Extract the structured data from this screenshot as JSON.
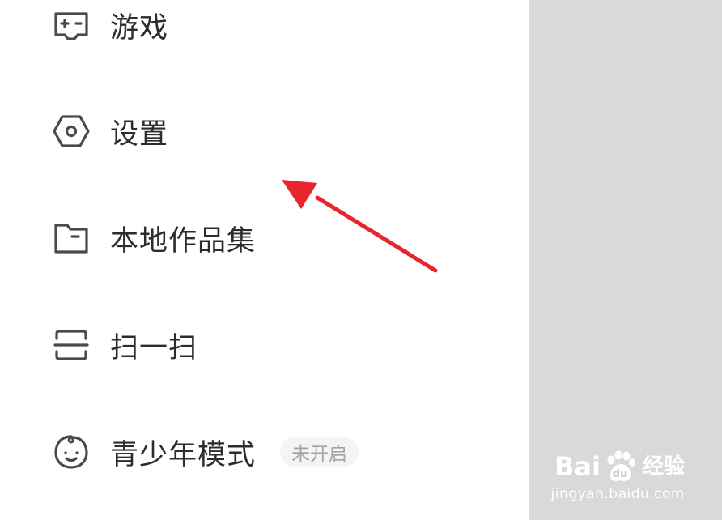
{
  "menu": {
    "items": [
      {
        "label": "游戏",
        "icon": "gamepad-icon"
      },
      {
        "label": "设置",
        "icon": "settings-hexagon-icon"
      },
      {
        "label": "本地作品集",
        "icon": "folder-icon"
      },
      {
        "label": "扫一扫",
        "icon": "scan-icon"
      },
      {
        "label": "青少年模式",
        "icon": "child-face-icon",
        "badge": "未开启"
      }
    ]
  },
  "colors": {
    "text": "#2c2c2c",
    "icon": "#4a4a4a",
    "badge_text": "#a3a3a3",
    "badge_bg": "#f4f4f4",
    "scrim": "#d9d9dc",
    "annotation_arrow": "#e8242d"
  },
  "watermark": {
    "brand_left": "Bai",
    "brand_right": "经验",
    "url": "jingyan.baidu.com",
    "icon": "paw-icon"
  }
}
